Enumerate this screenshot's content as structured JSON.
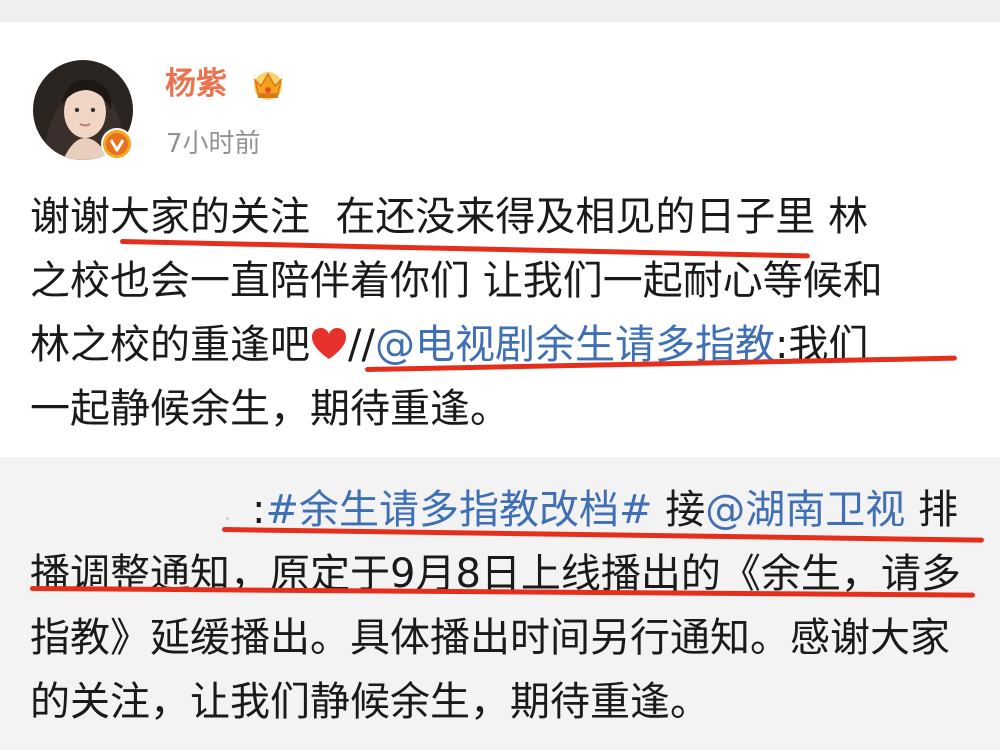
{
  "user": {
    "name": "杨紫",
    "time": "7小时前"
  },
  "post": {
    "line1": "谢谢大家的关注  在还没来得及相见的日子里 林",
    "line2": "之校也会一直陪伴着你们 让我们一起耐心等候和",
    "line3_text": "林之校的重逢吧",
    "line3_sep": "//",
    "line3_mention": "@电视剧余生请多指教",
    "line3_tail": ":我们",
    "line4": "一起静候余生，期待重逢。"
  },
  "repost": {
    "line1_prefix": ":",
    "line1_topic": "#余生请多指教改档#",
    "line1_mid": " 接",
    "line1_mention": "@湖南卫视",
    "line1_tail": " 排",
    "line2": "播调整通知，原定于9月8日上线播出的《余生，请多",
    "line3": "指教》延缓播出。具体播出时间另行通知。感谢大家",
    "line4": "的关注，让我们静候余生，期待重逢。"
  },
  "icons": {
    "crown": "crown-icon",
    "heart": "heart-icon",
    "verified": "verified-badge-icon"
  },
  "colors": {
    "username": "#eb7350",
    "link": "#3f6fb5",
    "annotation": "#e62e1c"
  }
}
